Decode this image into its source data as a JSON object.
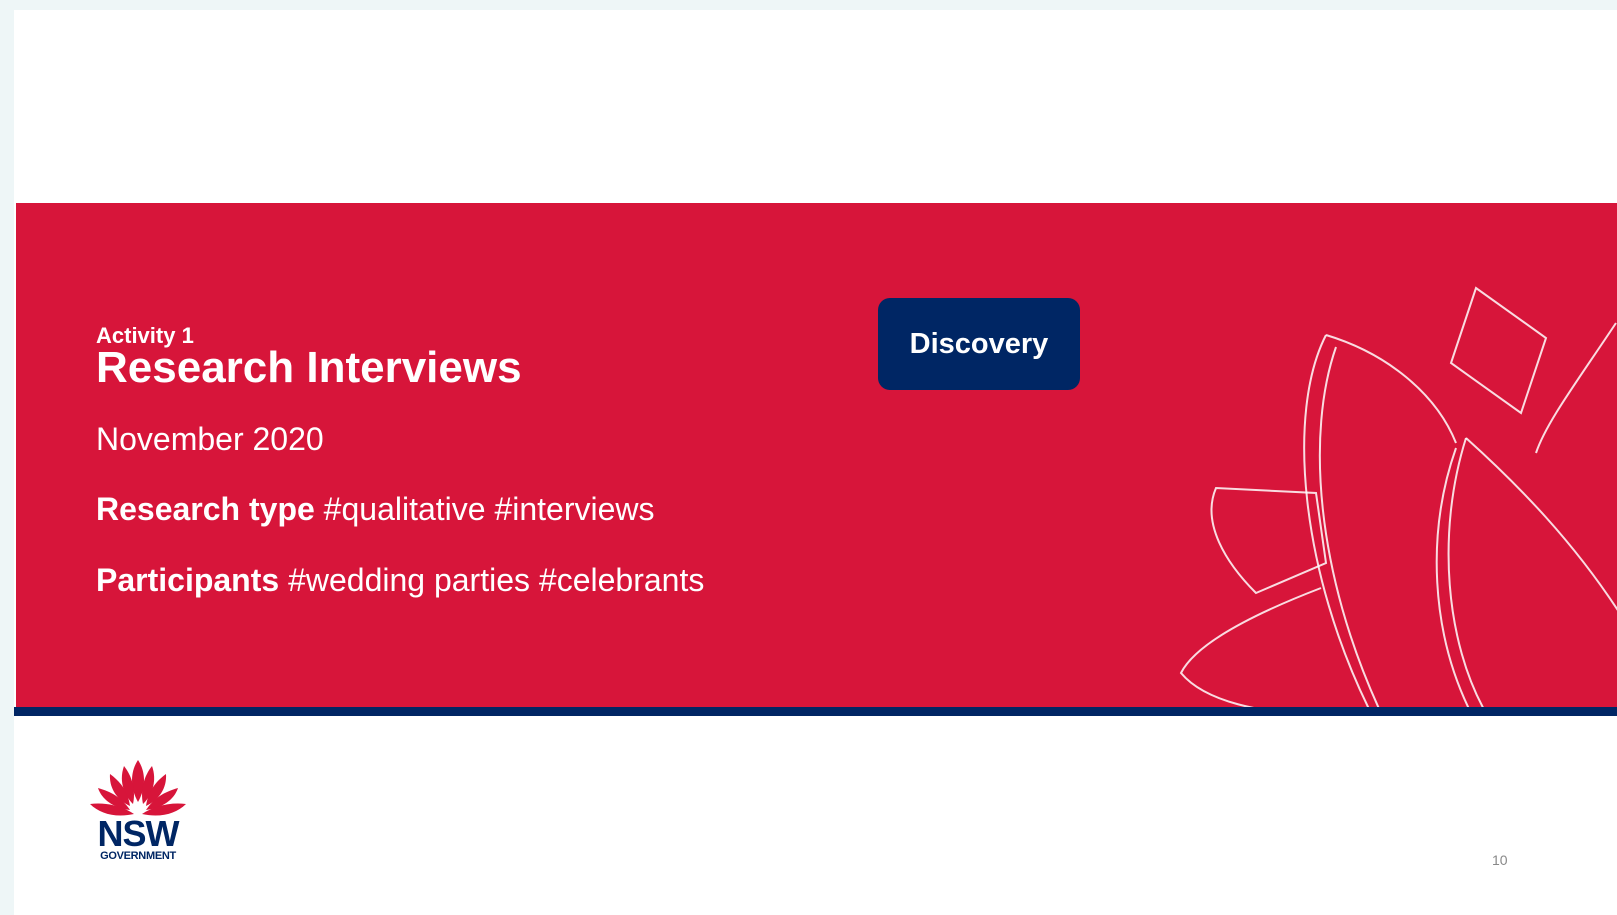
{
  "slide": {
    "activity": "Activity 1",
    "title": "Research Interviews",
    "date": "November 2020",
    "research_type": {
      "label": "Research type",
      "tags": "#qualitative #interviews"
    },
    "participants": {
      "label": "Participants",
      "tags": "#wedding parties #celebrants"
    },
    "badge": "Discovery",
    "page_number": "10"
  },
  "logo": {
    "name": "NSW",
    "sub": "GOVERNMENT",
    "icon": "waratah-icon"
  },
  "colors": {
    "red": "#d7153a",
    "navy": "#002664",
    "white": "#ffffff"
  }
}
